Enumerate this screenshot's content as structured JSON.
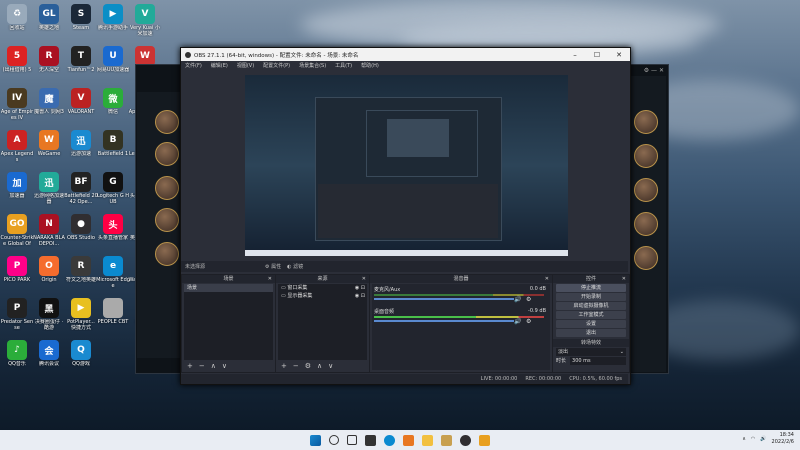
{
  "desktop": {
    "icons": [
      {
        "label": "回收站",
        "color": "#9ab",
        "glyph": "♻"
      },
      {
        "label": "英雄之地",
        "color": "#2a5f9a",
        "glyph": "GL"
      },
      {
        "label": "Steam",
        "color": "#1b2838",
        "glyph": "S"
      },
      {
        "label": "腾讯手游助手",
        "color": "#0b8ec6",
        "glyph": "▶"
      },
      {
        "label": "Very Kuai 小米加速",
        "color": "#2a9",
        "glyph": "V"
      },
      {
        "label": "(出租借用) 5",
        "color": "#d22",
        "glyph": "5"
      },
      {
        "label": "无人深空",
        "color": "#a12",
        "glyph": "R"
      },
      {
        "label": "Tianfun™2",
        "color": "#222",
        "glyph": "T"
      },
      {
        "label": "网易UU加速器",
        "color": "#1a6ad0",
        "glyph": "U"
      },
      {
        "label": "",
        "color": "#c33",
        "glyph": "W"
      },
      {
        "label": "Age of Empires IV",
        "color": "#4a3a20",
        "glyph": "IV"
      },
      {
        "label": "魔兽人 剑网3",
        "color": "#3a6bb0",
        "glyph": "魔"
      },
      {
        "label": "VALORANT",
        "color": "#b22",
        "glyph": "V"
      },
      {
        "label": "微信",
        "color": "#2bad3a",
        "glyph": "微"
      },
      {
        "label": "Apex Legends",
        "color": "#c22",
        "glyph": "A"
      },
      {
        "label": "Apex Legends",
        "color": "#c22",
        "glyph": "A"
      },
      {
        "label": "WeGame",
        "color": "#e87722",
        "glyph": "W"
      },
      {
        "label": "迅游加速",
        "color": "#1a8ad0",
        "glyph": "迅"
      },
      {
        "label": "Battlefield 1",
        "color": "#332",
        "glyph": "B"
      },
      {
        "label": "League of Legends",
        "color": "#c8a050",
        "glyph": "L"
      },
      {
        "label": "加速器",
        "color": "#1a6ad0",
        "glyph": "加"
      },
      {
        "label": "迅游网络加速器",
        "color": "#2a9",
        "glyph": "迅"
      },
      {
        "label": "Battlefield 2042 Ope...",
        "color": "#222",
        "glyph": "BF"
      },
      {
        "label": "Logitech G HUB",
        "color": "#111",
        "glyph": "G"
      },
      {
        "label": "头条直播伴侣",
        "color": "#f04",
        "glyph": "直"
      },
      {
        "label": "Counter-Strike Global Off...",
        "color": "#e8a020",
        "glyph": "GO"
      },
      {
        "label": "NARAKA BLADEPOI...",
        "color": "#a12",
        "glyph": "N"
      },
      {
        "label": "OBS Studio",
        "color": "#302e31",
        "glyph": "●"
      },
      {
        "label": "头条直播管家",
        "color": "#f04",
        "glyph": "头"
      },
      {
        "label": "英雄联盟客户端平台",
        "color": "#c8a050",
        "glyph": "L"
      },
      {
        "label": "PICO PARK",
        "color": "#f08",
        "glyph": "P"
      },
      {
        "label": "Origin",
        "color": "#f56c2d",
        "glyph": "O"
      },
      {
        "label": "符文之地英雄",
        "color": "#3a3a3a",
        "glyph": "R"
      },
      {
        "label": "Microsoft Edge",
        "color": "#0a8ad0",
        "glyph": "e"
      },
      {
        "label": "Wallpaper Engine: ...",
        "color": "#1a5a9a",
        "glyph": "W"
      },
      {
        "label": "Predator Sense",
        "color": "#222",
        "glyph": "P"
      },
      {
        "label": "决赛圈蛋仔 · 酷游",
        "color": "#111",
        "glyph": "黑"
      },
      {
        "label": "PotPlayer... 快捷方式",
        "color": "#e8c020",
        "glyph": "▶"
      },
      {
        "label": "PEOPLE CBT",
        "color": "#aaa",
        "glyph": ""
      },
      {
        "label": "喜虹深渊",
        "color": "#7a3ad0",
        "glyph": "喜"
      },
      {
        "label": "QQ音乐",
        "color": "#2bad3a",
        "glyph": "♪"
      },
      {
        "label": "腾讯会议",
        "color": "#1a6ad0",
        "glyph": "会"
      },
      {
        "label": "QQ游戏",
        "color": "#1a8ad0",
        "glyph": "Q"
      }
    ]
  },
  "obs": {
    "title": "OBS 27.1.1 (64-bit, windows) - 配置文件: 未命名 - 场景: 未命名",
    "menu": [
      "文件(F)",
      "编辑(E)",
      "视图(V)",
      "配置文件(P)",
      "场景集合(S)",
      "工具(T)",
      "帮助(H)"
    ],
    "source_bar": {
      "label": "未选择源",
      "props": "属性",
      "filters": "滤镜"
    },
    "scenes": {
      "header": "场景",
      "items": [
        "场景"
      ]
    },
    "sources": {
      "header": "来源",
      "items": [
        "窗口采集",
        "显示器采集"
      ]
    },
    "mixer": {
      "header": "混音器",
      "tracks": [
        {
          "name": "桌面音频",
          "db": "-0.9 dB",
          "level": 0.6
        },
        {
          "name": "麦克风/Aux",
          "db": "0.0 dB",
          "level": 0.82
        }
      ]
    },
    "controls": {
      "header": "控件",
      "buttons": [
        "停止推流",
        "开始录制",
        "启动虚拟摄像机",
        "工作室模式",
        "设置",
        "退出"
      ]
    },
    "transitions": {
      "header": "转场特效",
      "type": "淡出",
      "duration_label": "时长",
      "duration": "300 ms"
    },
    "status": {
      "live": "LIVE: 00:00:00",
      "rec": "REC: 00:00:00",
      "cpu": "CPU: 0.5%, 60.00 fps"
    }
  },
  "taskbar": {
    "time": "18:34",
    "date": "2022/2/6"
  }
}
